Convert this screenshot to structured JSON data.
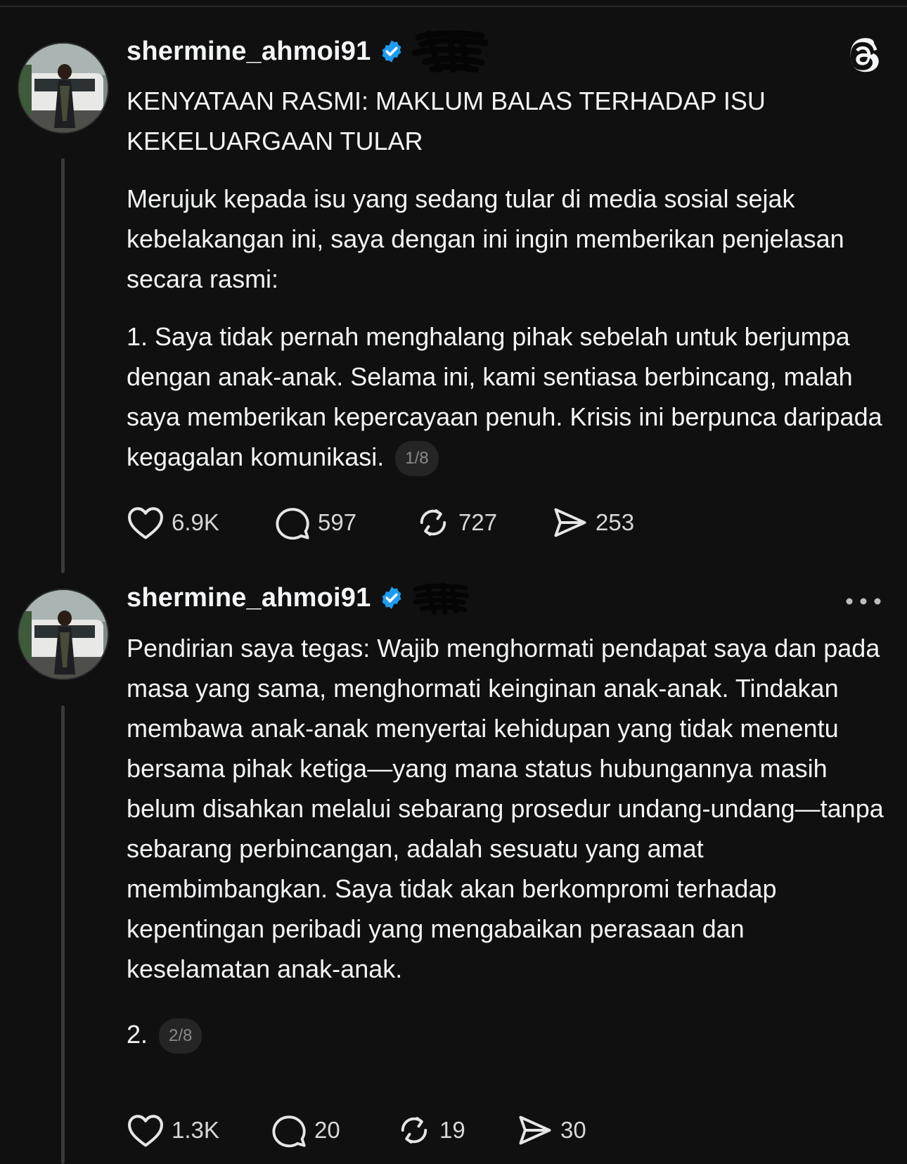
{
  "threads_logo": "threads-logo-icon",
  "posts": [
    {
      "username": "shermine_ahmoi91",
      "title": "KENYATAAN RASMI: MAKLUM BALAS TERHADAP ISU KEKELUARGAAN TULAR",
      "paragraph_1": "Merujuk kepada isu yang sedang tular di media sosial sejak kebelakangan ini, saya dengan ini ingin memberikan penjelasan secara rasmi:",
      "paragraph_2": "1. Saya tidak pernah menghalang pihak sebelah untuk berjumpa dengan anak-anak. Selama ini, kami sentiasa berbincang, malah saya memberikan kepercayaan penuh. Krisis ini berpunca daripada kegagalan komunikasi.",
      "pager": "1/8",
      "likes": "6.9K",
      "replies": "597",
      "reposts": "727",
      "shares": "253"
    },
    {
      "username": "shermine_ahmoi91",
      "paragraph_1": "Pendirian saya tegas: Wajib menghormati pendapat saya dan pada masa yang sama, menghormati keinginan anak-anak. Tindakan membawa anak-anak menyertai kehidupan yang tidak menentu bersama pihak ketiga—yang mana status hubungannya masih belum disahkan melalui sebarang prosedur undang-undang—tanpa sebarang perbincangan, adalah sesuatu yang amat membimbangkan. Saya tidak akan berkompromi terhadap kepentingan peribadi yang mengabaikan perasaan dan keselamatan anak-anak.",
      "paragraph_2": "2.",
      "pager": "2/8",
      "likes": "1.3K",
      "replies": "20",
      "reposts": "19",
      "shares": "30"
    }
  ],
  "colors": {
    "background": "#101010",
    "text": "#f3f5f7",
    "muted": "#8a8a8a",
    "verified": "#1d9bf0",
    "thread_line": "#3a3a3a"
  }
}
